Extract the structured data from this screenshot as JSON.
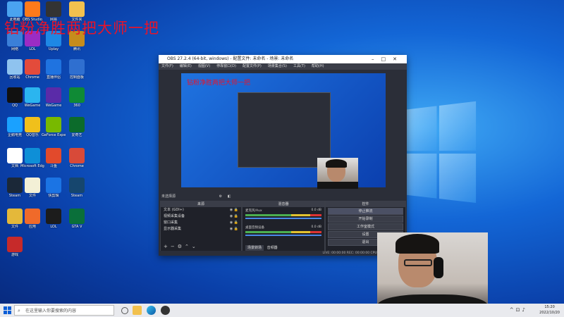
{
  "overlay": {
    "title": "钻粉净胜两把大师一把"
  },
  "desktop_icons": [
    {
      "label": "此电脑",
      "color": "#4aa3f0"
    },
    {
      "label": "OBS Studio",
      "color": "#ff7a1a"
    },
    {
      "label": "网易",
      "color": "#333"
    },
    {
      "label": "文件夹",
      "color": "#f2c14e"
    },
    {
      "label": "网络",
      "color": "#3b7fd8"
    },
    {
      "label": "LOL",
      "color": "#9b2cc4"
    },
    {
      "label": "Uplay",
      "color": "#1e88e5"
    },
    {
      "label": "腾讯",
      "color": "#c68c1c"
    },
    {
      "label": "回收站",
      "color": "#8fc3ef"
    },
    {
      "label": "Chrome",
      "color": "#e34b3b"
    },
    {
      "label": "直播伴侣",
      "color": "#1f73e0"
    },
    {
      "label": "控制面板",
      "color": "#2f6fd0"
    },
    {
      "label": "QQ",
      "color": "#111"
    },
    {
      "label": "WeGame",
      "color": "#2bb5ef"
    },
    {
      "label": "WeGame",
      "color": "#5a2ba8"
    },
    {
      "label": "360",
      "color": "#0f8a35"
    },
    {
      "label": "企鹅电竞",
      "color": "#1aa1ff"
    },
    {
      "label": "QQ音乐",
      "color": "#f0c01b"
    },
    {
      "label": "GeForce Experience",
      "color": "#78b900"
    },
    {
      "label": "爱奇艺",
      "color": "#0c6b2b"
    },
    {
      "label": "文档",
      "color": "#ffffff"
    },
    {
      "label": "Microsoft Edge",
      "color": "#0e8fd7"
    },
    {
      "label": "斗鱼",
      "color": "#e24a2c"
    },
    {
      "label": "Chrome",
      "color": "#d84a39"
    },
    {
      "label": "Steam",
      "color": "#1b2838"
    },
    {
      "label": "文件",
      "color": "#f3f0d6"
    },
    {
      "label": "快剪辑",
      "color": "#1b74e4"
    },
    {
      "label": "Steam",
      "color": "#16466e"
    },
    {
      "label": "文件",
      "color": "#e4b83a"
    },
    {
      "label": "应用",
      "color": "#f06a2a"
    },
    {
      "label": "LOL",
      "color": "#1c1c1c"
    },
    {
      "label": "GTA V",
      "color": "#0a6f3a"
    },
    {
      "label": "游戏",
      "color": "#c62a2a"
    }
  ],
  "obs": {
    "title": "OBS 27.2.4 (64-bit, windows) - 配置文件: 未命名 - 场景: 未命名",
    "menu": [
      "文件(F)",
      "编辑(E)",
      "视图(V)",
      "停靠窗口(D)",
      "配置文件(P)",
      "场景集合(S)",
      "工具(T)",
      "帮助(H)"
    ],
    "preview_title": "钻粉净胜两把大师一把",
    "sources_bar": "未选择源",
    "sources_header": "来源",
    "sources": [
      {
        "name": "文本 (GDI+)"
      },
      {
        "name": "视频采集设备"
      },
      {
        "name": "窗口采集"
      },
      {
        "name": "显示器采集"
      }
    ],
    "mixer_header": "混音器",
    "mixer": [
      {
        "name": "麦克风/Aux",
        "db": "0.0 dB"
      },
      {
        "name": "桌面音频设备",
        "db": "0.0 dB"
      }
    ],
    "controls_header": "控件",
    "controls": [
      "停止推流",
      "开始录制",
      "工作室模式",
      "设置",
      "退出"
    ],
    "tabs": [
      "场景转场",
      "音频器"
    ],
    "status": "LIVE: 00:00:00   REC: 00:00:00   CPU: 0.2%, 60.00 fps"
  },
  "taskbar": {
    "search_placeholder": "在这里输入你要搜索的内容",
    "time": "15:20",
    "date": "2022/10/20"
  }
}
